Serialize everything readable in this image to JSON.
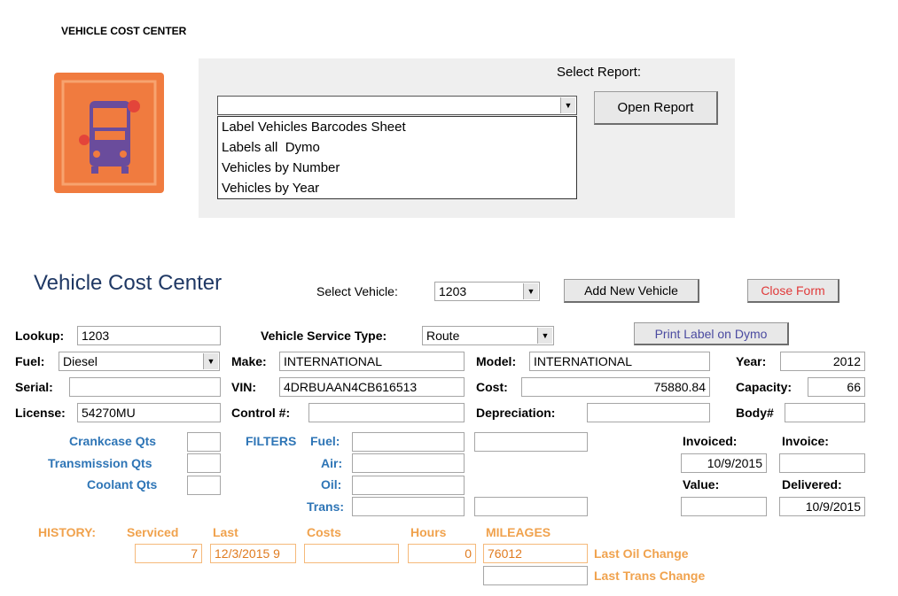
{
  "header": {
    "title": "VEHICLE COST CENTER"
  },
  "report_panel": {
    "select_label": "Select Report:",
    "selected_value": "",
    "open_button": "Open Report",
    "options": [
      "Label Vehicles Barcodes Sheet",
      "Labels all  Dymo",
      "Vehicles by Number",
      "Vehicles by Year"
    ]
  },
  "icons": {
    "logo": "school-bus-icon",
    "dropdown": "chevron-down-icon"
  },
  "colors": {
    "logo_bg": "#f07b3f",
    "logo_bus": "#6a4c9c",
    "section_blue": "#2e75b6",
    "history_orange": "#f0a24d",
    "close_red": "#e03a3a",
    "dymo_purple": "#4a4aa0"
  },
  "form": {
    "title": "Vehicle Cost Center",
    "select_vehicle_label": "Select Vehicle:",
    "select_vehicle_value": "1203",
    "add_button": "Add New Vehicle",
    "close_button": "Close Form",
    "print_button": "Print Label on Dymo",
    "lookup_label": "Lookup:",
    "lookup_value": "1203",
    "service_type_label": "Vehicle Service Type:",
    "service_type_value": "Route",
    "fuel_label": "Fuel:",
    "fuel_value": "Diesel",
    "make_label": "Make:",
    "make_value": "INTERNATIONAL",
    "model_label": "Model:",
    "model_value": "INTERNATIONAL",
    "year_label": "Year:",
    "year_value": "2012",
    "serial_label": "Serial:",
    "serial_value": "",
    "vin_label": "VIN:",
    "vin_value": "4DRBUAAN4CB616513",
    "cost_label": "Cost:",
    "cost_value": "75880.84",
    "capacity_label": "Capacity:",
    "capacity_value": "66",
    "license_label": "License:",
    "license_value": "54270MU",
    "control_label": "Control #:",
    "control_value": "",
    "depreciation_label": "Depreciation:",
    "depreciation_value": "",
    "body_label": "Body#",
    "body_value": "",
    "crankcase_label": "Crankcase Qts",
    "transmission_label": "Transmission Qts",
    "coolant_label": "Coolant Qts",
    "filters_label": "FILTERS",
    "fuel_filter_label": "Fuel:",
    "air_filter_label": "Air:",
    "oil_filter_label": "Oil:",
    "trans_filter_label": "Trans:",
    "invoiced_label": "Invoiced:",
    "invoiced_value": "10/9/2015",
    "invoice_label": "Invoice:",
    "invoice_value": "",
    "value_label": "Value:",
    "value_value": "",
    "delivered_label": "Delivered:",
    "delivered_value": "10/9/2015"
  },
  "history": {
    "label": "HISTORY:",
    "serviced_label": "Serviced",
    "serviced_value": "7",
    "last_label": "Last",
    "last_value": "12/3/2015 9",
    "costs_label": "Costs",
    "costs_value": "",
    "hours_label": "Hours",
    "hours_value": "0",
    "mileages_label": "MILEAGES",
    "last_oil_mileage": "76012",
    "last_oil_label": "Last Oil Change",
    "last_trans_mileage": "",
    "last_trans_label": "Last Trans Change"
  }
}
